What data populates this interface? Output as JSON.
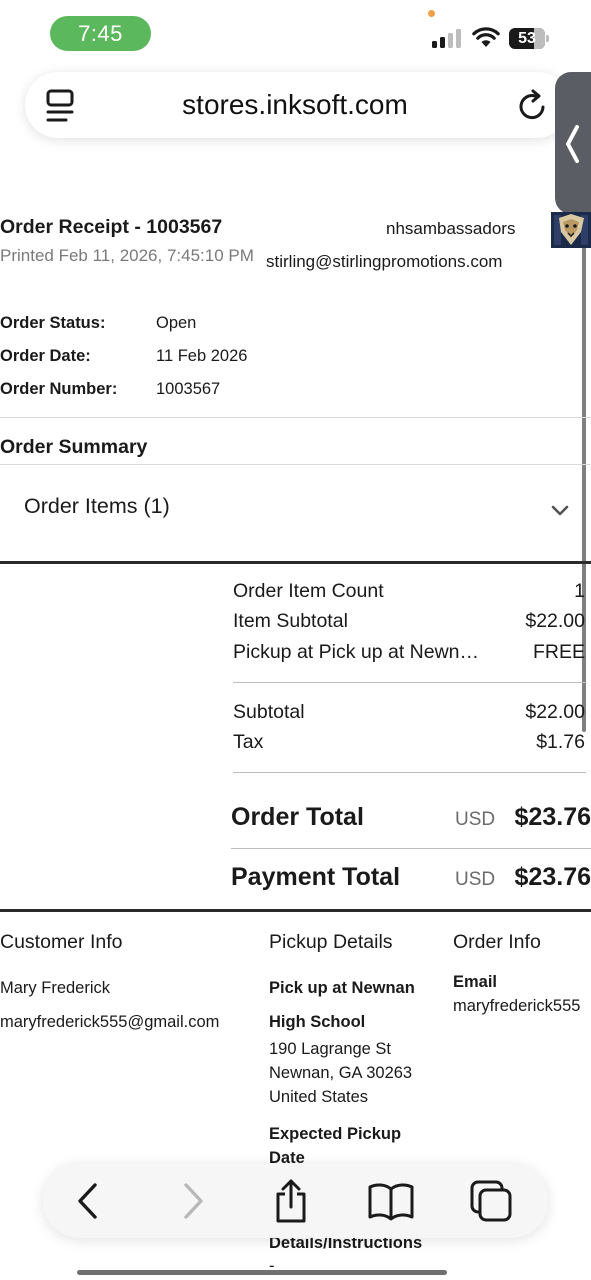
{
  "status_bar": {
    "time": "7:45",
    "battery": "53"
  },
  "browser": {
    "url": "stores.inksoft.com"
  },
  "receipt": {
    "title": "Order Receipt - 1003567",
    "printed": "Printed Feb 11, 2026, 7:45:10 PM",
    "store_name": "nhsambassadors",
    "store_email": "stirling@stirlingpromotions.com"
  },
  "order_meta": [
    {
      "label": "Order Status:",
      "value": "Open"
    },
    {
      "label": "Order Date:",
      "value": "11 Feb 2026"
    },
    {
      "label": "Order Number:",
      "value": "1003567"
    }
  ],
  "summary": {
    "heading": "Order Summary",
    "items_toggle": "Order Items (1)",
    "lines": [
      {
        "label": "Order Item Count",
        "value": "1"
      },
      {
        "label": "Item Subtotal",
        "value": "$22.00"
      },
      {
        "label": "Pickup at Pick up at Newn…",
        "value": "FREE"
      }
    ],
    "subtotal": {
      "label": "Subtotal",
      "value": "$22.00"
    },
    "tax": {
      "label": "Tax",
      "value": "$1.76"
    },
    "order_total": {
      "label": "Order Total",
      "currency": "USD",
      "value": "$23.76"
    },
    "payment_total": {
      "label": "Payment Total",
      "currency": "USD",
      "value": "$23.76"
    }
  },
  "customer_info": {
    "heading": "Customer Info",
    "name": "Mary Frederick",
    "email": "maryfrederick555@gmail.com"
  },
  "pickup_details": {
    "heading": "Pickup Details",
    "location_line1": "Pick up at Newnan",
    "location_line2": "High School",
    "address_line1": "190 Lagrange St",
    "address_line2": "Newnan, GA 30263",
    "address_line3": "United States",
    "expected_label_line1": "Expected Pickup",
    "expected_label_line2": "Date",
    "instructions_label": "Details/Instructions",
    "instructions_value": "-"
  },
  "order_info": {
    "heading": "Order Info",
    "email_label": "Email",
    "email_value": "maryfrederick555"
  },
  "icons": {
    "reader": "reader-mode-icon",
    "reload": "reload-icon",
    "back": "back-arrow-icon",
    "forward": "forward-arrow-icon",
    "share": "share-icon",
    "bookmarks": "book-icon",
    "tabs": "tabs-icon"
  },
  "colors": {
    "time_pill": "#5cb85c",
    "accent_dark": "#2b2b2b"
  }
}
